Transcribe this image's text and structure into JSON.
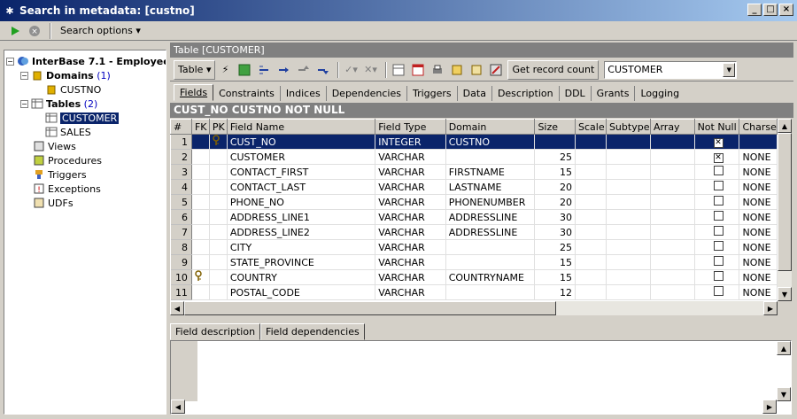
{
  "window": {
    "title": "Search in metadata: [custno]"
  },
  "toolbar": {
    "search_options": "Search options"
  },
  "tree": {
    "db": "InterBase 7.1 - Employee",
    "domains_label": "Domains",
    "domains_count": "(1)",
    "domain_item": "CUSTNO",
    "tables_label": "Tables",
    "tables_count": "(2)",
    "table_items": [
      "CUSTOMER",
      "SALES"
    ],
    "others": [
      "Views",
      "Procedures",
      "Triggers",
      "Exceptions",
      "UDFs"
    ]
  },
  "table_header": "Table [CUSTOMER]",
  "toolbar2": {
    "table_btn": "Table",
    "get_record_count": "Get record count",
    "combo_value": "CUSTOMER"
  },
  "tabs": [
    "Fields",
    "Constraints",
    "Indices",
    "Dependencies",
    "Triggers",
    "Data",
    "Description",
    "DDL",
    "Grants",
    "Logging"
  ],
  "field_title": "CUST_NO CUSTNO NOT NULL",
  "columns": [
    "#",
    "FK",
    "PK",
    "Field Name",
    "Field Type",
    "Domain",
    "Size",
    "Scale",
    "Subtype",
    "Array",
    "Not Null",
    "Charse"
  ],
  "rows": [
    {
      "n": "1",
      "fk": "",
      "pk": "key",
      "name": "CUST_NO",
      "type": "INTEGER",
      "domain": "CUSTNO",
      "size": "",
      "notnull": true,
      "charset": ""
    },
    {
      "n": "2",
      "fk": "",
      "pk": "",
      "name": "CUSTOMER",
      "type": "VARCHAR",
      "domain": "",
      "size": "25",
      "notnull": true,
      "charset": "NONE"
    },
    {
      "n": "3",
      "fk": "",
      "pk": "",
      "name": "CONTACT_FIRST",
      "type": "VARCHAR",
      "domain": "FIRSTNAME",
      "size": "15",
      "notnull": false,
      "charset": "NONE"
    },
    {
      "n": "4",
      "fk": "",
      "pk": "",
      "name": "CONTACT_LAST",
      "type": "VARCHAR",
      "domain": "LASTNAME",
      "size": "20",
      "notnull": false,
      "charset": "NONE"
    },
    {
      "n": "5",
      "fk": "",
      "pk": "",
      "name": "PHONE_NO",
      "type": "VARCHAR",
      "domain": "PHONENUMBER",
      "size": "20",
      "notnull": false,
      "charset": "NONE"
    },
    {
      "n": "6",
      "fk": "",
      "pk": "",
      "name": "ADDRESS_LINE1",
      "type": "VARCHAR",
      "domain": "ADDRESSLINE",
      "size": "30",
      "notnull": false,
      "charset": "NONE"
    },
    {
      "n": "7",
      "fk": "",
      "pk": "",
      "name": "ADDRESS_LINE2",
      "type": "VARCHAR",
      "domain": "ADDRESSLINE",
      "size": "30",
      "notnull": false,
      "charset": "NONE"
    },
    {
      "n": "8",
      "fk": "",
      "pk": "",
      "name": "CITY",
      "type": "VARCHAR",
      "domain": "",
      "size": "25",
      "notnull": false,
      "charset": "NONE"
    },
    {
      "n": "9",
      "fk": "",
      "pk": "",
      "name": "STATE_PROVINCE",
      "type": "VARCHAR",
      "domain": "",
      "size": "15",
      "notnull": false,
      "charset": "NONE"
    },
    {
      "n": "10",
      "fk": "key",
      "pk": "",
      "name": "COUNTRY",
      "type": "VARCHAR",
      "domain": "COUNTRYNAME",
      "size": "15",
      "notnull": false,
      "charset": "NONE"
    },
    {
      "n": "11",
      "fk": "",
      "pk": "",
      "name": "POSTAL_CODE",
      "type": "VARCHAR",
      "domain": "",
      "size": "12",
      "notnull": false,
      "charset": "NONE"
    }
  ],
  "bottom_tabs": [
    "Field description",
    "Field dependencies"
  ]
}
